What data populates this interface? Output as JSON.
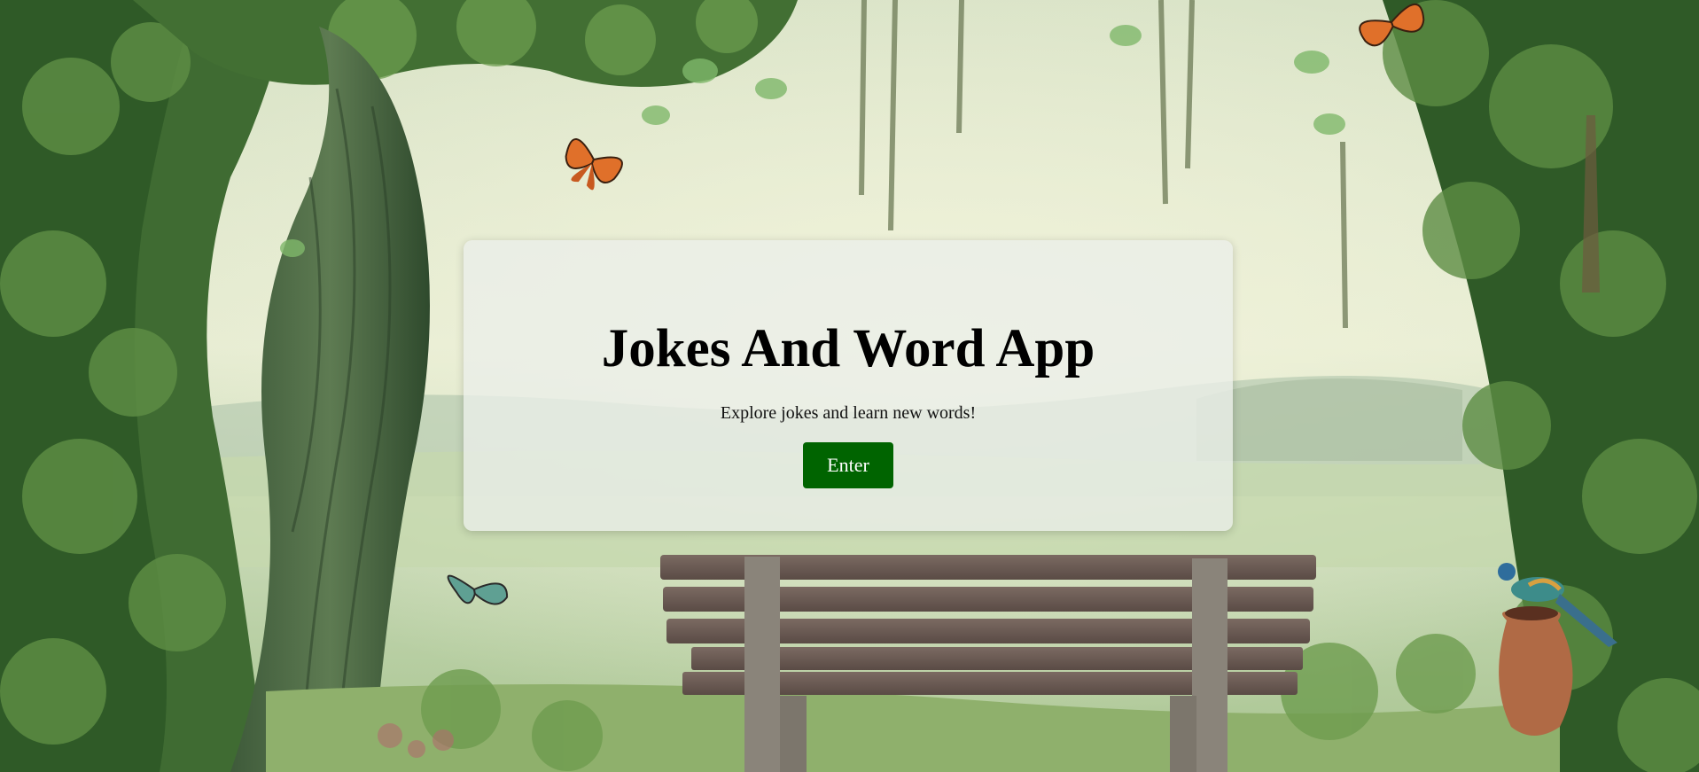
{
  "page": {
    "title": "Jokes And Word App",
    "subtitle": "Explore jokes and learn new words!",
    "enter_label": "Enter"
  },
  "colors": {
    "button_bg": "#006400",
    "button_text": "#ffffff",
    "card_bg": "rgba(235,238,233,0.78)"
  },
  "background": {
    "description_icons": [
      "tree-icon",
      "bench-icon",
      "butterfly-icon",
      "bird-icon",
      "vase-icon"
    ]
  }
}
